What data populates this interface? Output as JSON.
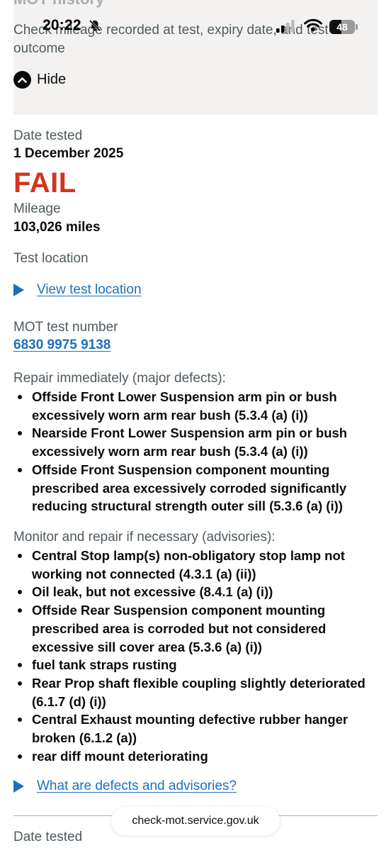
{
  "status_bar": {
    "time": "20:22",
    "battery_level": "48"
  },
  "history_panel": {
    "title": "MOT history",
    "description": "Check mileage recorded at test, expiry date, and test outcome",
    "hide_label": "Hide"
  },
  "test": {
    "date_label": "Date tested",
    "date_value": "1 December 2025",
    "result": "FAIL",
    "mileage_label": "Mileage",
    "mileage_value": "103,026 miles",
    "location_label": "Test location",
    "location_link": "View test location",
    "number_label": "MOT test number",
    "number_value": "6830 9975 9138"
  },
  "major_defects": {
    "heading": "Repair immediately (major defects):",
    "items": [
      "Offside Front Lower Suspension arm pin or bush excessively worn arm rear bush (5.3.4 (a) (i))",
      "Nearside Front Lower Suspension arm pin or bush excessively worn arm rear bush (5.3.4 (a) (i))",
      "Offside Front Suspension component mounting prescribed area excessively corroded significantly reducing structural strength outer sill (5.3.6 (a) (i))"
    ]
  },
  "advisories": {
    "heading": "Monitor and repair if necessary (advisories):",
    "items": [
      "Central Stop lamp(s) non-obligatory stop lamp not working not connected (4.3.1 (a) (ii))",
      "Oil leak, but not excessive (8.4.1 (a) (i))",
      "Offside Rear Suspension component mounting prescribed area is corroded but not considered excessive sill cover area (5.3.6 (a) (i))",
      "fuel tank straps rusting",
      "Rear Prop shaft flexible coupling slightly deteriorated (6.1.7 (d) (i))",
      "Central Exhaust mounting defective rubber hanger broken (6.1.2 (a))",
      "rear diff mount deteriorating"
    ]
  },
  "help_link": "What are defects and advisories?",
  "next_test": {
    "date_label": "Date tested"
  },
  "browser": {
    "url": "check-mot.service.gov.uk"
  }
}
